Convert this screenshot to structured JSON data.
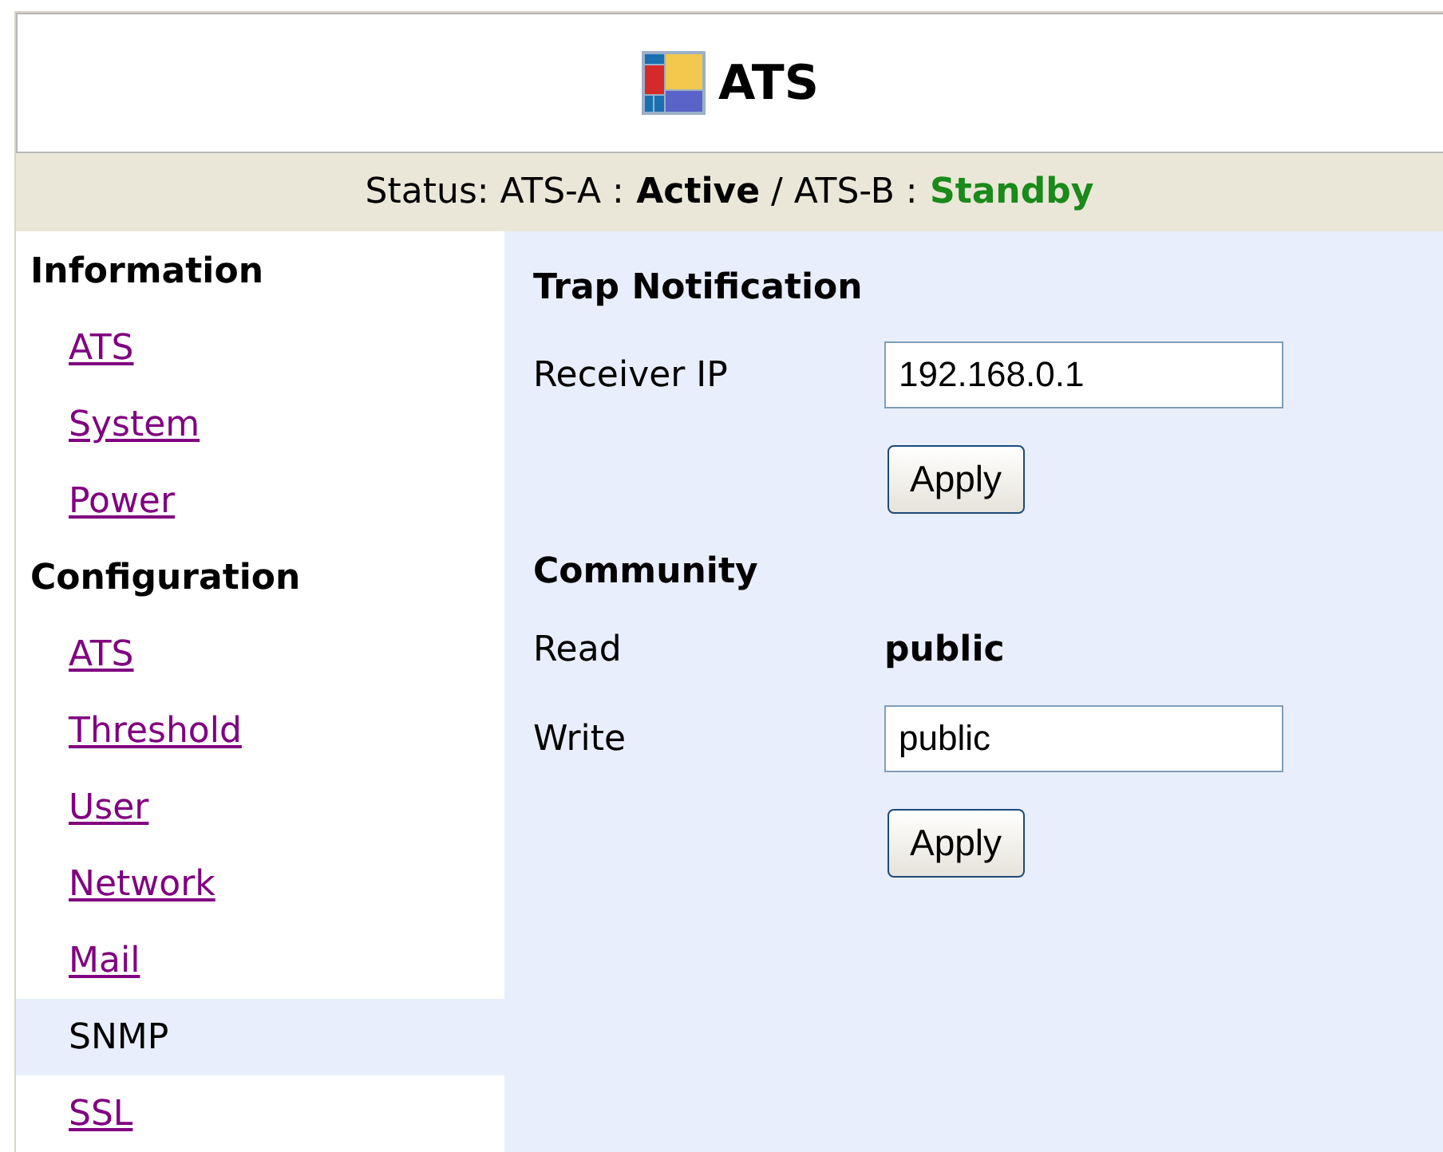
{
  "header": {
    "title": "ATS"
  },
  "status": [
    {
      "kind": "plain",
      "text": "Status: ATS-A :"
    },
    {
      "kind": "bold",
      "text": "Active"
    },
    {
      "kind": "plain",
      "text": "/ ATS-B :"
    },
    {
      "kind": "ok",
      "text": "Standby"
    }
  ],
  "sidebar": [
    {
      "heading": "Information",
      "items": [
        {
          "label": "ATS",
          "selected": false
        },
        {
          "label": "System",
          "selected": false
        },
        {
          "label": "Power",
          "selected": false
        }
      ]
    },
    {
      "heading": "Configuration",
      "items": [
        {
          "label": "ATS",
          "selected": false
        },
        {
          "label": "Threshold",
          "selected": false
        },
        {
          "label": "User",
          "selected": false
        },
        {
          "label": "Network",
          "selected": false
        },
        {
          "label": "Mail",
          "selected": false
        },
        {
          "label": "SNMP",
          "selected": true
        },
        {
          "label": "SSL",
          "selected": false
        }
      ]
    }
  ],
  "sections": [
    {
      "title": "Trap Notification",
      "rows": [
        {
          "kind": "field",
          "label": "Receiver IP",
          "value": "192.168.0.1"
        },
        {
          "kind": "button",
          "label": "Apply"
        }
      ]
    },
    {
      "title": "Community",
      "rows": [
        {
          "kind": "text",
          "label": "Read",
          "value": "public"
        },
        {
          "kind": "field",
          "label": "Write",
          "value": "public"
        },
        {
          "kind": "button",
          "label": "Apply"
        }
      ]
    }
  ]
}
